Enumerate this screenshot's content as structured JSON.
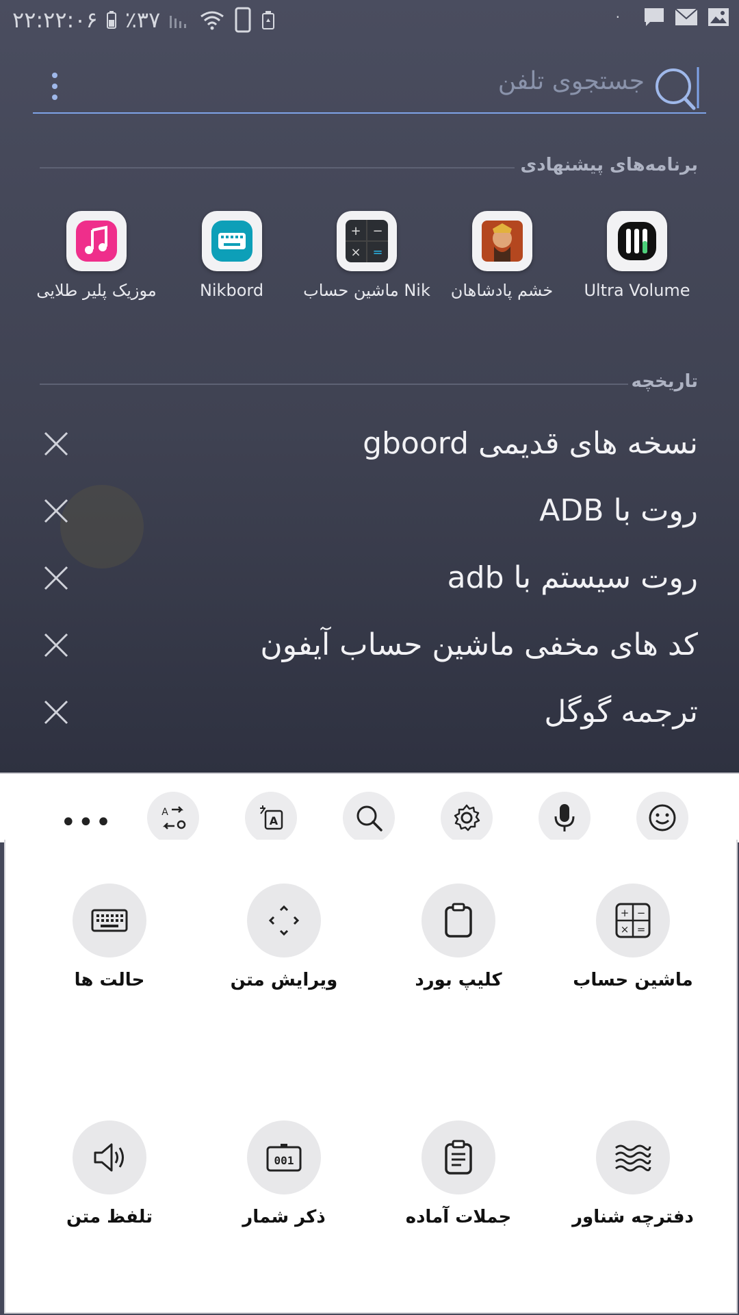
{
  "status_bar": {
    "time": "۲۲:۲۲:۰۶",
    "battery": "٪۳۷",
    "icons": [
      "battery-icon",
      "signal-icon",
      "wifi-icon",
      "phone-icon",
      "recycle-icon",
      "dot-icon",
      "message-icon",
      "mail-icon",
      "image-icon"
    ]
  },
  "search": {
    "placeholder": "جستجوی تلفن"
  },
  "suggested": {
    "title": "برنامه‌های پیشنهادی",
    "apps": [
      {
        "label": "Ultra Volume",
        "icon": "ultra-volume-icon"
      },
      {
        "label": "خشم پادشاهان",
        "icon": "game-warrior-icon"
      },
      {
        "label": "ماشین حساب Nik",
        "icon": "calculator-icon"
      },
      {
        "label": "Nikbord",
        "icon": "keyboard-icon"
      },
      {
        "label": "موزیک پلیر طلایی",
        "icon": "music-icon"
      }
    ]
  },
  "history": {
    "title": "تاریخچه",
    "items": [
      "نسخه های قدیمی gboord",
      "روت با ADB",
      "روت سیستم با adb",
      "کد های مخفی ماشین حساب آیفون",
      "ترجمه گوگل"
    ]
  },
  "keyboard_toolbar": {
    "buttons": [
      "emoji-icon",
      "microphone-icon",
      "settings-icon",
      "search-icon",
      "translate-icon",
      "convert-icon"
    ],
    "more_label": "•••"
  },
  "tools": [
    {
      "label": "ماشین حساب",
      "icon": "calculator-icon"
    },
    {
      "label": "کلیپ بورد",
      "icon": "clipboard-icon"
    },
    {
      "label": "ویرایش متن",
      "icon": "text-edit-icon"
    },
    {
      "label": "حالت ها",
      "icon": "keyboard-icon"
    },
    {
      "label": "دفترچه شناور",
      "icon": "waves-icon"
    },
    {
      "label": "جملات آماده",
      "icon": "notes-icon"
    },
    {
      "label": "ذکر شمار",
      "icon": "counter-icon"
    },
    {
      "label": "تلفظ متن",
      "icon": "speaker-icon"
    }
  ],
  "colors": {
    "accent": "#7fa3e8",
    "background": "#45485a",
    "panel": "#ffffff"
  }
}
